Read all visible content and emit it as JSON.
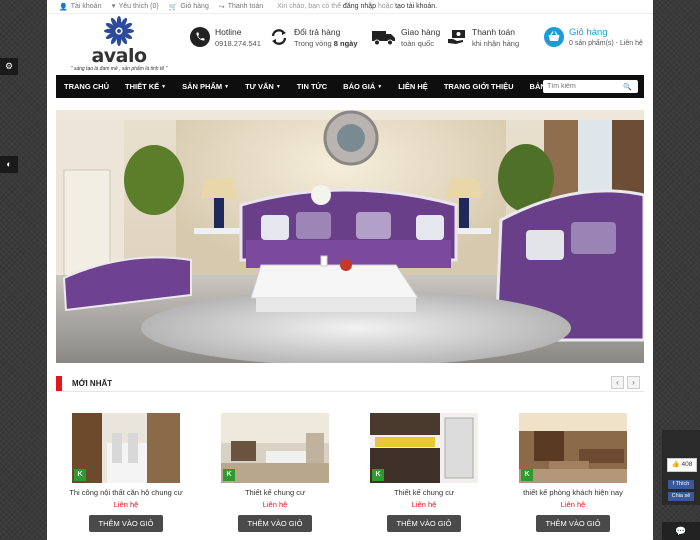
{
  "topbar": {
    "account": "Tài khoản",
    "wishlist": "Yêu thích (0)",
    "cart": "Giỏ hàng",
    "checkout": "Thanh toán",
    "welcome_prefix": "Xin chào, bạn có thể",
    "login": "đăng nhập",
    "or": "hoặc",
    "register": "tạo tài khoản."
  },
  "logo": {
    "brand": "avalo",
    "slogan": "\" sáng tạo là đam mê , sản phẩm là tinh tế \""
  },
  "header": {
    "hotline_label": "Hotline",
    "hotline_number": "0918.274.541",
    "return_label": "Đổi trả hàng",
    "return_prefix": "Trong vòng",
    "return_days": "8 ngày",
    "delivery_label": "Giao hàng",
    "delivery_sub": "toàn quốc",
    "payment_label": "Thanh toán",
    "payment_sub": "khi nhận hàng",
    "cart_label": "Giỏ hàng",
    "cart_sub": "0 sản phẩm(s) - Liên hệ"
  },
  "nav": {
    "items": [
      "TRANG CHỦ",
      "THIẾT KẾ",
      "SẢN PHẨM",
      "TƯ VẤN",
      "TIN TỨC",
      "BÁO GIÁ",
      "LIÊN HỆ",
      "TRANG GIỚI THIỆU",
      "BẢN ĐỒ"
    ],
    "dropdown": [
      false,
      true,
      true,
      true,
      false,
      true,
      false,
      false,
      false
    ],
    "search_placeholder": "Tìm kiếm"
  },
  "section": {
    "title": "MỚI NHẤT"
  },
  "products": [
    {
      "name": "Thi công nội thất căn hộ chung cư",
      "price": "Liên hệ",
      "button": "THÊM VÀO GIỎ"
    },
    {
      "name": "Thiết kế chung cư",
      "price": "Liên hệ",
      "button": "THÊM VÀO GIỎ"
    },
    {
      "name": "Thiết kế chung cư",
      "price": "Liên hệ",
      "button": "THÊM VÀO GIỎ"
    },
    {
      "name": "thiết kế phòng khách hiện nay",
      "price": "Liên hệ",
      "button": "THÊM VÀO GIỎ"
    }
  ],
  "social": {
    "like_count": "408",
    "like_label": "Thích",
    "share_label": "Chia sẻ"
  },
  "colors": {
    "accent_red": "#e8141b",
    "cart_blue": "#1e9bd7",
    "nav_bg": "#0e0e0e"
  }
}
